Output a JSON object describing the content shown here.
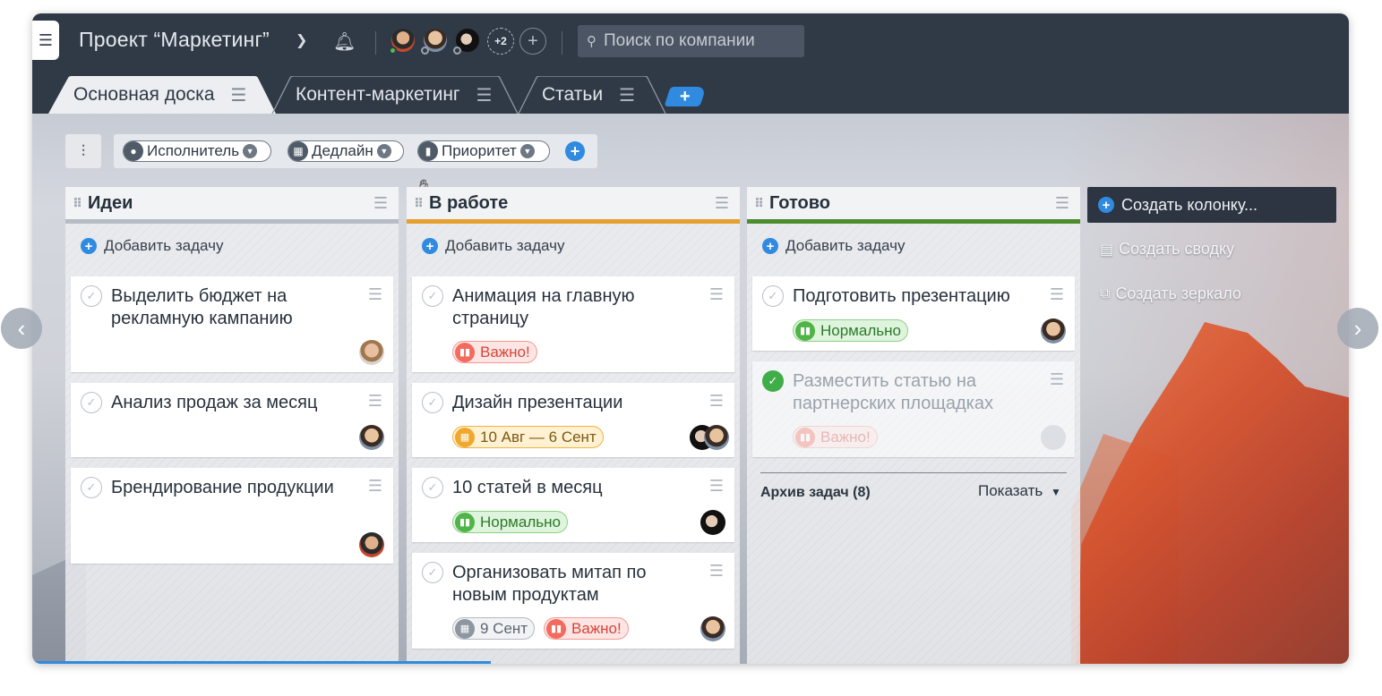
{
  "header": {
    "project_title": "Проект “Маркетинг”",
    "search_placeholder": "Поиск по компании",
    "more_members": "+2"
  },
  "tabs": [
    {
      "label": "Основная доска",
      "active": true
    },
    {
      "label": "Контент-маркетинг",
      "active": false
    },
    {
      "label": "Статьи",
      "active": false
    }
  ],
  "filters": [
    {
      "label": "Исполнитель",
      "icon": "user-icon"
    },
    {
      "label": "Дедлайн",
      "icon": "calendar-icon"
    },
    {
      "label": "Приоритет",
      "icon": "priority-bars-icon"
    }
  ],
  "columns": [
    {
      "title": "Идеи",
      "accent_color": "#b6bcc5",
      "add_task_label": "Добавить задачу",
      "cards": [
        {
          "title": "Выделить бюджет на рекламную кампанию"
        },
        {
          "title": "Анализ продаж за месяц"
        },
        {
          "title": "Брендирование продукции"
        }
      ]
    },
    {
      "title": "В работе",
      "accent_color": "#e5a02e",
      "add_task_label": "Добавить задачу",
      "cards": [
        {
          "title": "Анимация на главную страницу",
          "badge": "Важно!"
        },
        {
          "title": "Дизайн презентации",
          "badge": "10 Авг — 6 Сент"
        },
        {
          "title": "10 статей в месяц",
          "badge": "Нормально"
        },
        {
          "title": "Организовать митап по новым продуктам",
          "date": "9 Сент",
          "badge": "Важно!"
        }
      ]
    },
    {
      "title": "Готово",
      "accent_color": "#4f8b2f",
      "add_task_label": "Добавить задачу",
      "cards": [
        {
          "title": "Подготовить презентацию",
          "badge": "Нормально"
        },
        {
          "title": "Разместить статью на партнерских площадках",
          "badge": "Важно!",
          "done": true
        }
      ],
      "archive_label": "Архив задач (8)",
      "archive_show": "Показать"
    }
  ],
  "side_actions": {
    "create_column": "Создать колонку...",
    "create_summary": "Создать сводку",
    "create_mirror": "Создать зеркало"
  },
  "colors": {
    "accent": "#2f8ae0",
    "topbar": "#303a47",
    "priority_high": "#f26b5e",
    "priority_normal": "#4fb548",
    "deadline": "#f0a82c",
    "done": "#3fae48"
  }
}
